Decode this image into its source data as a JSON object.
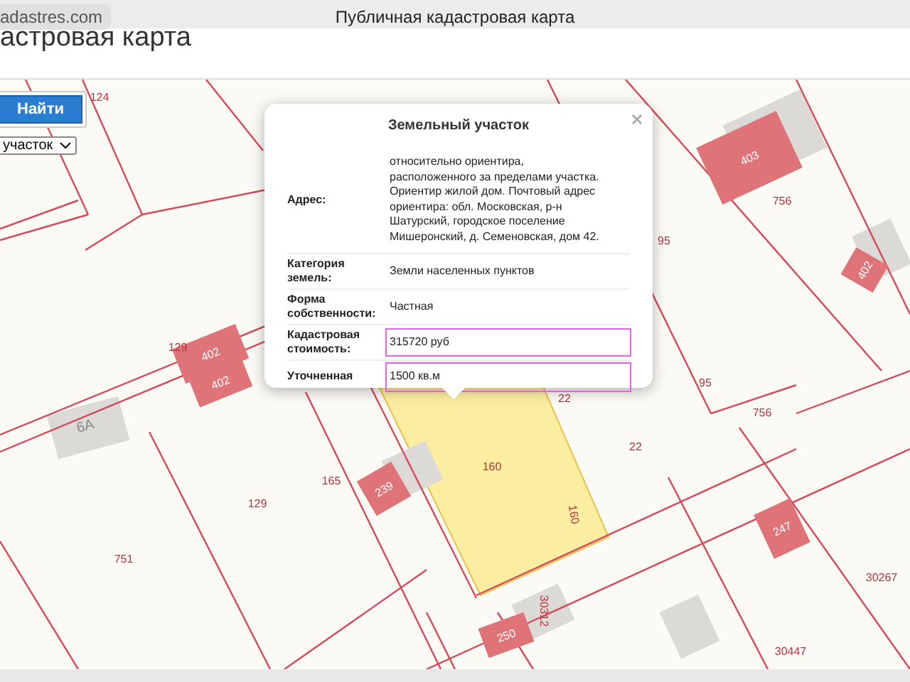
{
  "browser": {
    "address": "adastres.com",
    "title": "Публичная кадастровая карта"
  },
  "page": {
    "heading": "астровая карта",
    "search_button": "Найти",
    "type_select": "участок"
  },
  "popup": {
    "title": "Земельный участок",
    "rows": [
      {
        "label": "Адрес:",
        "value": "относительно ориентира, расположенного за пределами участка. Ориентир жилой дом. Почтовый адрес ориентира: обл. Московская, р-н Шатурский, городское поселение Мишеронский, д. Семеновская, дом 42.",
        "highlighted": false
      },
      {
        "label": "Категория земель:",
        "value": "Земли населенных пунктов",
        "highlighted": false
      },
      {
        "label": "Форма собственности:",
        "value": "Частная",
        "highlighted": false
      },
      {
        "label": "Кадастровая стоимость:",
        "value": "315720 руб",
        "highlighted": true
      },
      {
        "label": "Уточненная",
        "value": "1500 кв.м",
        "highlighted": true
      }
    ]
  },
  "map": {
    "parcel_numbers": [
      "124",
      "129",
      "6А",
      "95",
      "756",
      "95",
      "756",
      "22",
      "22",
      "165",
      "129",
      "751",
      "160",
      "160",
      "30312",
      "30447",
      "30267"
    ],
    "building_numbers": [
      "402",
      "402",
      "403",
      "402",
      "239",
      "250",
      "247"
    ]
  }
}
